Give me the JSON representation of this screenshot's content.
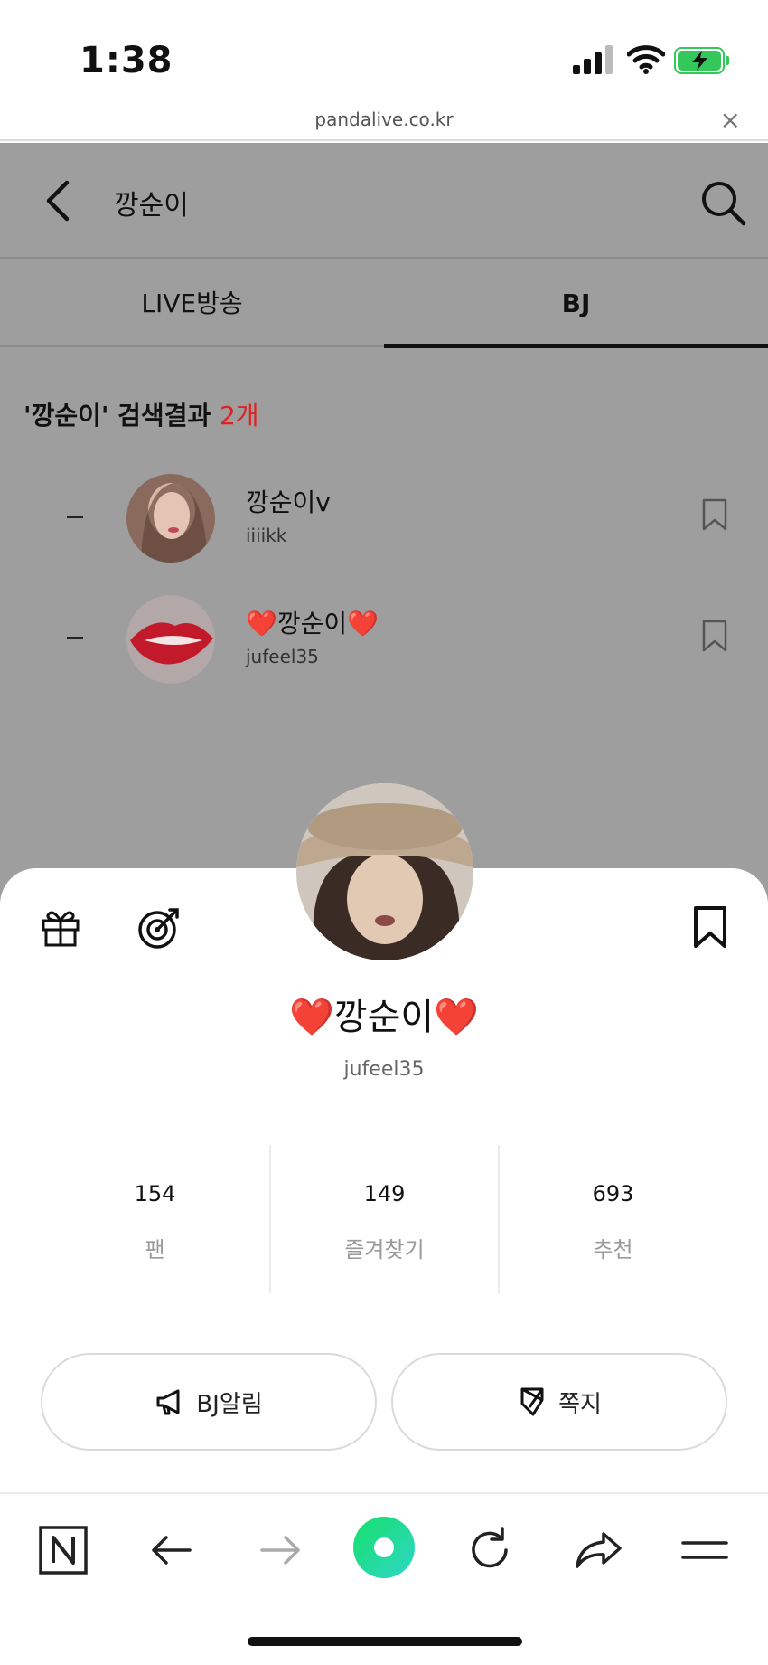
{
  "status_bar": {
    "time": "1:38"
  },
  "url_bar": {
    "url": "pandalive.co.kr",
    "close": "×"
  },
  "header": {
    "title": "깡순이"
  },
  "tabs": [
    {
      "label": "LIVE방송",
      "active": false
    },
    {
      "label": "BJ",
      "active": true
    }
  ],
  "search_result": {
    "prefix": "'깡순이' 검색결과 ",
    "count": "2개"
  },
  "results": [
    {
      "nickname": "깡순이v",
      "id": "iiiikk"
    },
    {
      "nickname": "❤️깡순이❤️",
      "id": "jufeel35"
    }
  ],
  "profile": {
    "nickname": "❤️깡순이❤️",
    "id": "jufeel35",
    "stats": [
      {
        "value": "154",
        "label": "팬"
      },
      {
        "value": "149",
        "label": "즐겨찾기"
      },
      {
        "value": "693",
        "label": "추천"
      }
    ],
    "buttons": {
      "notify": "BJ알림",
      "message": "쪽지"
    }
  },
  "colors": {
    "accent_red": "#dd2222",
    "dim_overlay": "#9e9e9e",
    "toolbar_green": "#22dd77"
  }
}
